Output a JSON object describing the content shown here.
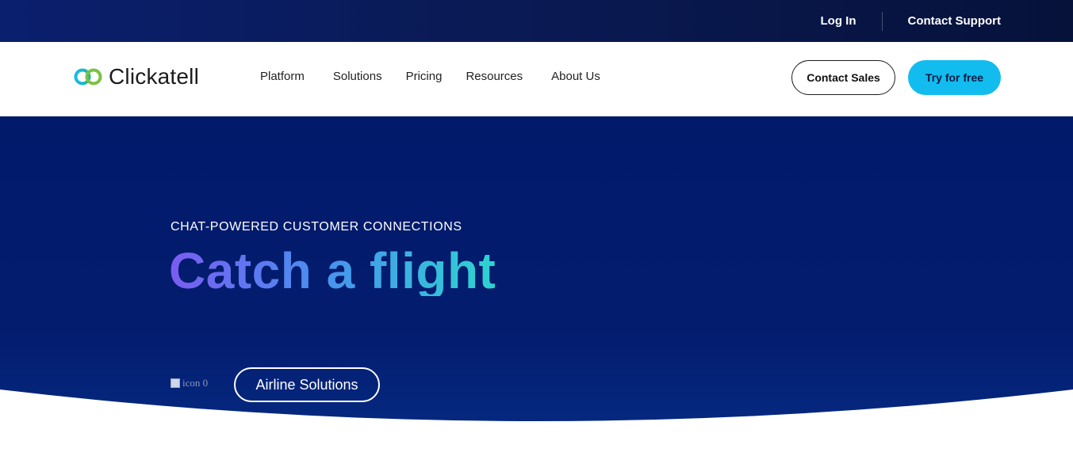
{
  "topbar": {
    "login_label": "Log In",
    "support_label": "Contact Support"
  },
  "navbar": {
    "brand": "Clickatell",
    "menu": [
      "Platform",
      "Solutions",
      "Pricing",
      "Resources",
      "About Us"
    ],
    "contact_sales_label": "Contact Sales",
    "try_free_label": "Try for free"
  },
  "hero": {
    "eyebrow": "CHAT-POWERED CUSTOMER CONNECTIONS",
    "headline": "Catch a flight",
    "image_alt": "icon 0",
    "cta_label": "Airline Solutions"
  },
  "colors": {
    "hero_bg": "#031a6b",
    "accent_cyan": "#12bcee",
    "headline_gradient_start": "#7a5cf0",
    "headline_gradient_end": "#2dd4d0"
  }
}
